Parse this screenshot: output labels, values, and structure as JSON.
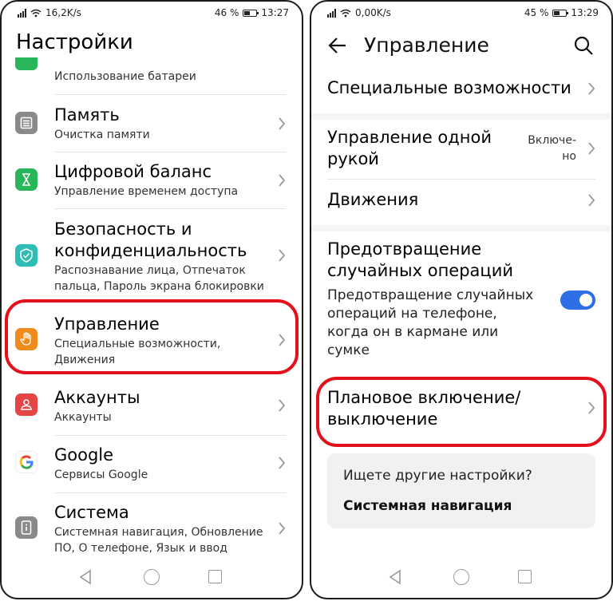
{
  "left": {
    "status": {
      "speed": "16,2K/s",
      "battery": "46 %",
      "time": "13:27",
      "battery_level": 0.46
    },
    "title": "Настройки",
    "partial_item": "Использование батареи",
    "items": [
      {
        "icon": "memory-icon",
        "color": "#8a8a8a",
        "label": "Память",
        "sub": "Очистка памяти"
      },
      {
        "icon": "hourglass-icon",
        "color": "#29b55a",
        "label": "Цифровой баланс",
        "sub": "Управление временем доступа"
      },
      {
        "icon": "shield-check-icon",
        "color": "#2fbcb2",
        "label1": "Безопасность и",
        "label2": "конфиденциальность",
        "sub1": "Распознавание лица, Отпечаток",
        "sub2": "пальца, Пароль экрана блокировки"
      },
      {
        "icon": "hand-icon",
        "color": "#f08a1c",
        "label": "Управление",
        "sub1": "Специальные возможности,",
        "sub2": "Движения"
      },
      {
        "icon": "account-icon",
        "color": "#e64545",
        "label": "Аккаунты",
        "sub": "Аккаунты"
      },
      {
        "icon": "google-icon",
        "color": "#ffffff",
        "label": "Google",
        "sub": "Сервисы Google"
      },
      {
        "icon": "system-info-icon",
        "color": "#8a8a8a",
        "label": "Система",
        "sub1": "Системная навигация, Обновление",
        "sub2": "ПО, О телефоне, Язык и ввод"
      }
    ]
  },
  "right": {
    "status": {
      "speed": "0,00K/s",
      "battery": "45 %",
      "time": "13:29",
      "battery_level": 0.45
    },
    "title": "Управление",
    "accessibility": "Специальные возможности",
    "one_hand": {
      "label1": "Управление одной",
      "label2": "рукой",
      "value1": "Включе-",
      "value2": "но"
    },
    "motions": "Движения",
    "accidental": {
      "label1": "Предотвращение",
      "label2": "случайных операций",
      "desc1": "Предотвращение случайных",
      "desc2": "операций на телефоне,",
      "desc3": "когда он в кармане или",
      "desc4": "сумке",
      "enabled": true
    },
    "schedule": {
      "label1": "Плановое включение/",
      "label2": "выключение"
    },
    "card": {
      "question": "Ищете другие настройки?",
      "link": "Системная навигация"
    }
  },
  "colors": {
    "highlight": "#e3111b",
    "toggle": "#2e6ee6"
  }
}
